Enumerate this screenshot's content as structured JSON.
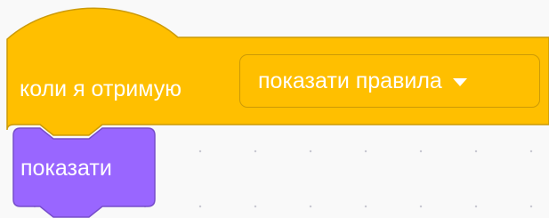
{
  "event_block": {
    "label": "коли я отримую",
    "dropdown_value": "показати правила",
    "dropdown_icon": "caret-down-icon",
    "fill_color": "#ffbf00",
    "border_color": "#cc9a06"
  },
  "looks_block": {
    "label": "показати",
    "fill_color": "#9966ff",
    "border_color": "#774dcb"
  },
  "workspace": {
    "background_color": "#f9f9f9",
    "grid_dot_color": "#c9c9d2"
  }
}
